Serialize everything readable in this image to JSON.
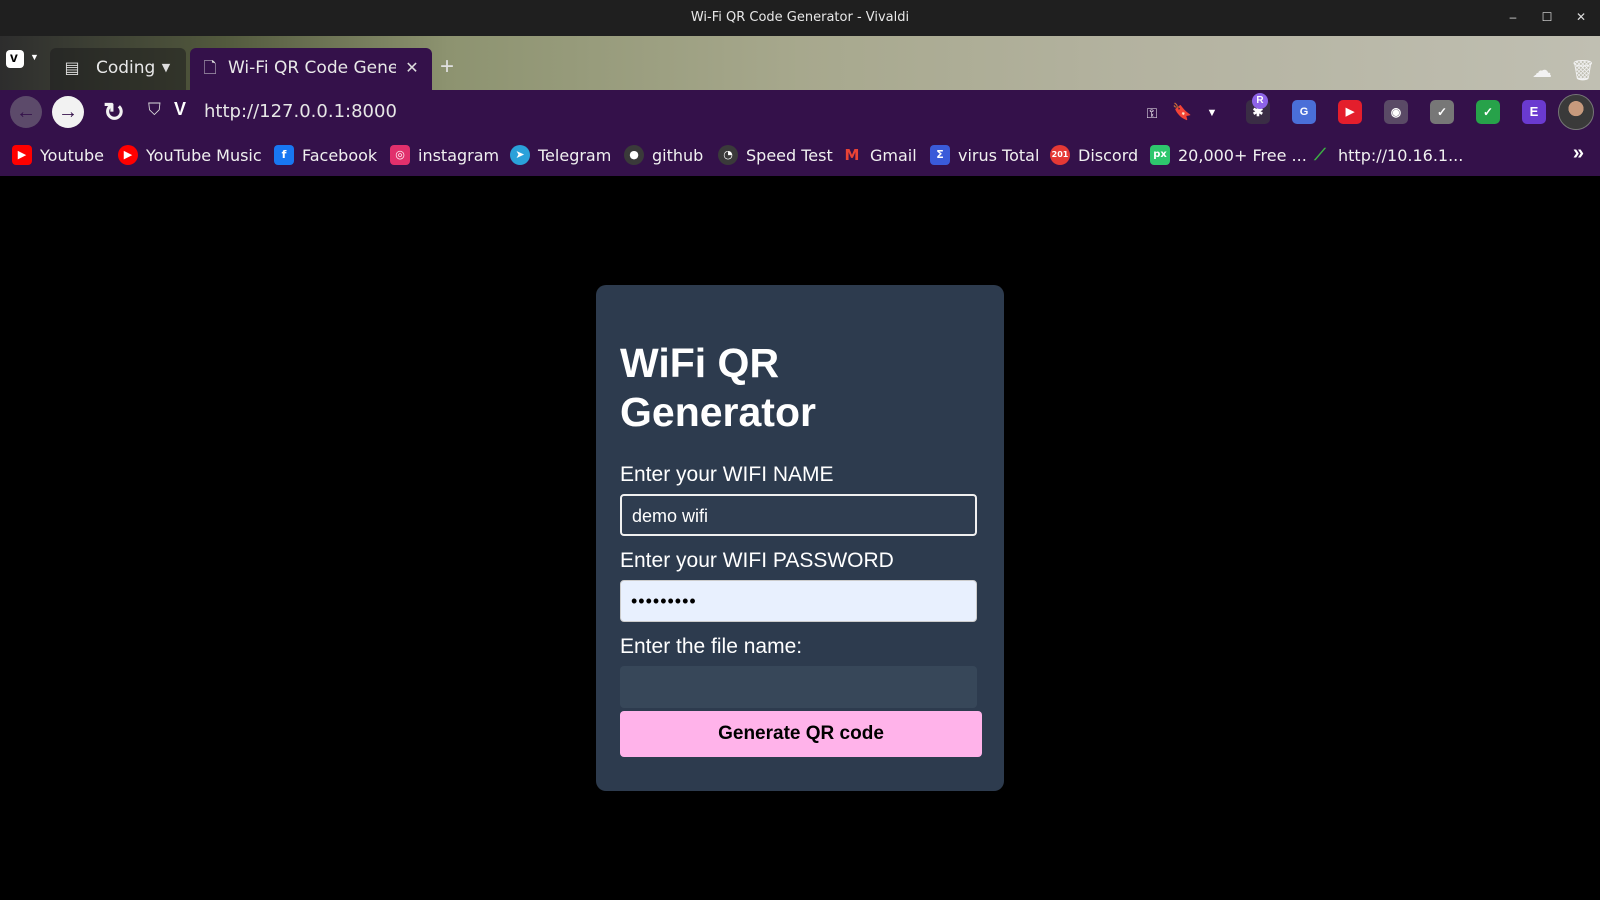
{
  "window": {
    "title": "Wi-Fi QR Code Generator - Vivaldi",
    "controls": {
      "minimize": "–",
      "maximize": "☐",
      "close": "✕"
    }
  },
  "tabs": {
    "stack_label": "Coding",
    "active_label": "Wi-Fi QR Code Genera",
    "new_tab": "+"
  },
  "address": {
    "url": "http://127.0.0.1:8000"
  },
  "bookmarks": [
    {
      "label": "Youtube",
      "icon": "youtube-icon",
      "color": "#ff0000"
    },
    {
      "label": "YouTube Music",
      "icon": "youtube-music-icon",
      "color": "#ff0000"
    },
    {
      "label": "Facebook",
      "icon": "facebook-icon",
      "color": "#1877f2"
    },
    {
      "label": "instagram",
      "icon": "instagram-icon",
      "color": "#e1306c"
    },
    {
      "label": "Telegram",
      "icon": "telegram-icon",
      "color": "#2aa1da"
    },
    {
      "label": "github",
      "icon": "github-icon",
      "color": "#555555"
    },
    {
      "label": "Speed Test",
      "icon": "speedtest-icon",
      "color": "#555555"
    },
    {
      "label": "Gmail",
      "icon": "gmail-icon",
      "color": "#ea4335"
    },
    {
      "label": "virus Total",
      "icon": "virustotal-icon",
      "color": "#3a5bd9"
    },
    {
      "label": "Discord",
      "icon": "discord-icon",
      "color": "#e53935"
    },
    {
      "label": "20,000+ Free ...",
      "icon": "pixabay-icon",
      "color": "#2ec66d"
    },
    {
      "label": "http://10.16.1...",
      "icon": "link-icon",
      "color": "#2e7d32"
    }
  ],
  "form": {
    "heading": "WiFi QR Generator",
    "name_label": "Enter your WIFI NAME",
    "name_value": "demo wifi",
    "password_label": "Enter your WIFI PASSWORD",
    "password_value": "•••••••••",
    "file_label": "Enter the file name:",
    "file_value": "",
    "submit_label": "Generate QR code"
  },
  "colors": {
    "browser_accent": "#34114a",
    "card_bg": "#2d3b4e",
    "button_bg": "#ffb3ea"
  }
}
